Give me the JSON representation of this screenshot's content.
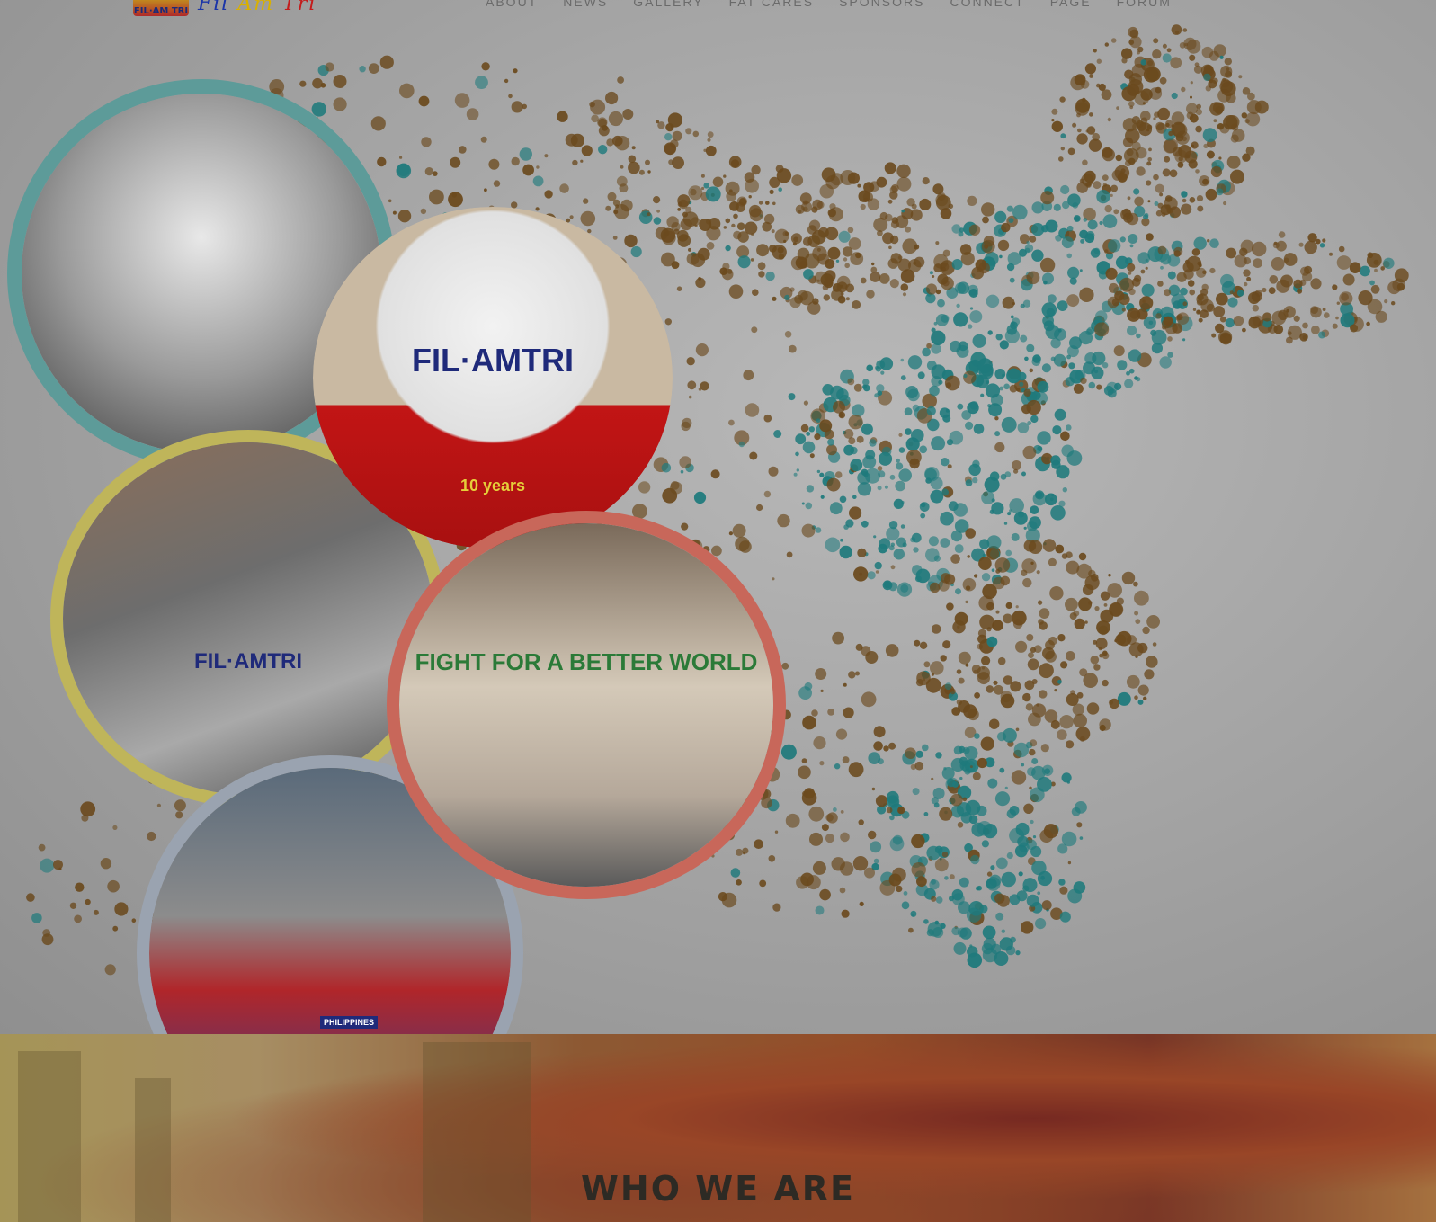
{
  "header": {
    "logo_badge": "FIL·AM TRI",
    "logo_text": {
      "fil": "Fil",
      "am": "Am",
      "tri": "Tri"
    },
    "nav": [
      "ABOUT",
      "NEWS",
      "GALLERY",
      "FAT CARES",
      "SPONSORS",
      "CONNECT",
      "PAGE",
      "FORUM"
    ]
  },
  "hero": {
    "photos": {
      "cap": {
        "brand": "FIL·AMTRI",
        "years": "10 years"
      },
      "jersey": {
        "text": "FIL·AMTRI"
      },
      "shirt": {
        "text": "FIGHT FOR A BETTER WORLD"
      },
      "group": {
        "sign": "PHILIPPINES"
      }
    }
  },
  "sections": {
    "who_we_are": {
      "title": "WHO WE ARE"
    }
  },
  "colors": {
    "teal": "#5d9b99",
    "gold": "#bfb55a",
    "coral": "#c8675a",
    "brown_particles": "#6b4a1e",
    "teal_particles": "#1f7a7c"
  }
}
